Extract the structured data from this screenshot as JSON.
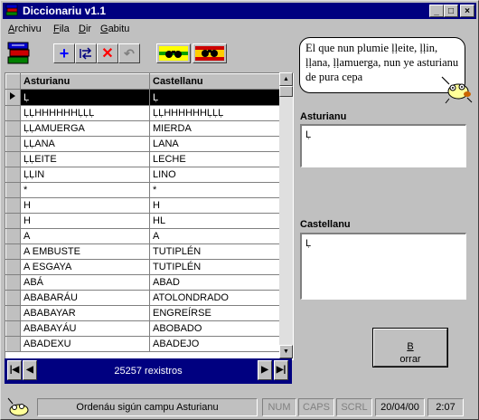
{
  "window": {
    "title": "Diccionariu  v1.1",
    "controls": [
      "_",
      "□",
      "×"
    ]
  },
  "menu": [
    {
      "accel": "A",
      "rest": "rchivu"
    },
    {
      "accel": "F",
      "rest": "ila"
    },
    {
      "accel": "D",
      "rest": "ir"
    },
    {
      "accel": "G",
      "rest": "abitu"
    }
  ],
  "toolbar": {
    "add": "+",
    "delete": "✕",
    "undo": "↶"
  },
  "grid": {
    "headers": [
      "Asturianu",
      "Castellanu"
    ],
    "rows": [
      [
        "Ḷ",
        "Ḷ"
      ],
      [
        "ḶḶHHHHHHḶḶḶ",
        "ḶḶHHHHHHḶḶḶ"
      ],
      [
        "ḶḶAMUERGA",
        "MIERDA"
      ],
      [
        "ḶḶANA",
        "LANA"
      ],
      [
        "ḶḶEITE",
        "LECHE"
      ],
      [
        "ḶḶIN",
        "LINO"
      ],
      [
        "*",
        "*"
      ],
      [
        "H",
        "H"
      ],
      [
        "H",
        "HL"
      ],
      [
        "A",
        "A"
      ],
      [
        "A EMBUSTE",
        "TUTIPLÉN"
      ],
      [
        "A ESGAYA",
        "TUTIPLÉN"
      ],
      [
        "ABÁ",
        "ABAD"
      ],
      [
        "ABABARÁU",
        "ATOLONDRADO"
      ],
      [
        "ABABAYAR",
        "ENGREÍRSE"
      ],
      [
        "ABABAYÁU",
        "ABOBADO"
      ],
      [
        "ABADEXU",
        "ABADEJO"
      ]
    ],
    "selected_row": 0
  },
  "nav": {
    "first": "|◀",
    "prev": "◀",
    "next": "▶",
    "last": "▶|",
    "record_count": "25257 rexistros"
  },
  "bubble_text": "El que nun plumie ḷḷeite, ḷḷin, ḷḷana, ḷḷamuerga, nun ye asturianu de pura cepa",
  "asturianu": {
    "label": "Asturianu",
    "value": "Ḷ"
  },
  "castellanu": {
    "label": "Castellanu",
    "value": "Ḷ"
  },
  "clear_button": {
    "accel": "B",
    "rest": "orrar"
  },
  "statusbar": {
    "message": "Ordenáu sigún campu Asturianu",
    "num": "NUM",
    "caps": "CAPS",
    "scrl": "SCRL",
    "date": "20/04/00",
    "time": "2:07"
  },
  "colors": {
    "title": "#000080",
    "face": "#c0c0c0",
    "selection": "#000000",
    "add": "#0000ff",
    "delete": "#ff0000"
  }
}
